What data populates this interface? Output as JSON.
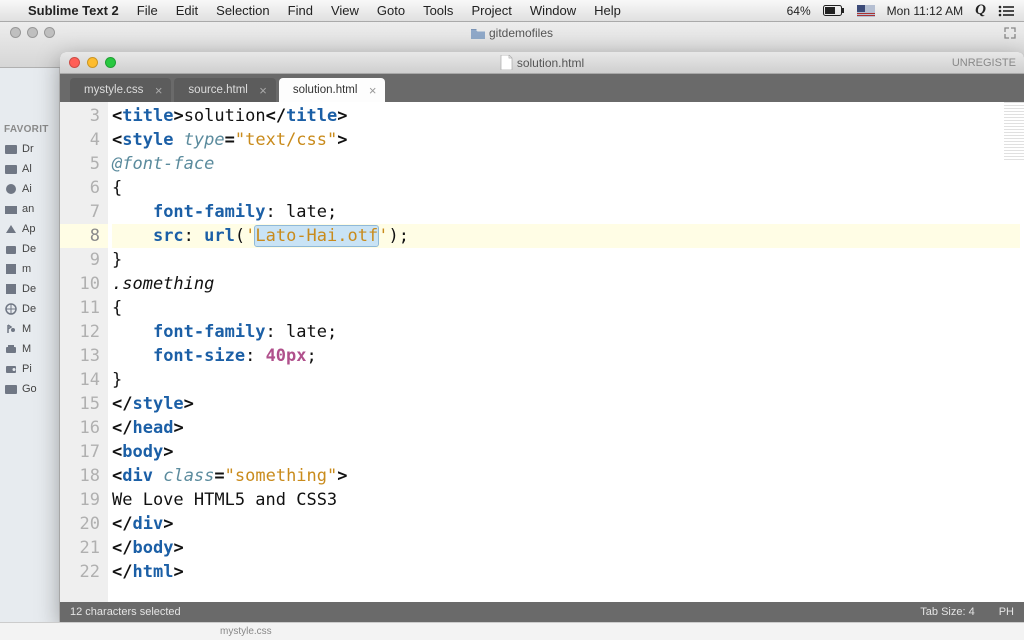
{
  "menubar": {
    "app": "Sublime Text 2",
    "items": [
      "File",
      "Edit",
      "Selection",
      "Find",
      "View",
      "Goto",
      "Tools",
      "Project",
      "Window",
      "Help"
    ],
    "battery": "64%",
    "clock": "Mon 11:12 AM"
  },
  "finder": {
    "title": "gitdemofiles"
  },
  "sidebar": {
    "header": "FAVORIT",
    "items": [
      "Dr",
      "Al",
      "Ai",
      "an",
      "Ap",
      "De",
      "m",
      "De",
      "De",
      "M",
      "M",
      "Pi",
      "Go"
    ]
  },
  "sublime": {
    "title": "solution.html",
    "unregistered": "UNREGISTE",
    "tabs": [
      {
        "label": "mystyle.css",
        "active": false
      },
      {
        "label": "source.html",
        "active": false
      },
      {
        "label": "solution.html",
        "active": true
      }
    ],
    "gutter_start": 3,
    "gutter_end": 22,
    "highlighted_line": 8,
    "selection_text": "Lato-Hai.otf",
    "code": {
      "l3": {
        "tag": "title",
        "text": "solution"
      },
      "l4": {
        "tag": "style",
        "attr": "type",
        "val": "\"text/css\""
      },
      "l5": "@font-face",
      "l6": "{",
      "l7": {
        "prop": "font-family",
        "val": "late"
      },
      "l8": {
        "prop": "src",
        "url": "Lato-Hai.otf"
      },
      "l9": "}",
      "l10": ".something",
      "l11": "{",
      "l12": {
        "prop": "font-family",
        "val": "late"
      },
      "l13": {
        "prop": "font-size",
        "num": "40",
        "unit": "px"
      },
      "l14": "}",
      "l15": {
        "close": "style"
      },
      "l16": {
        "close": "head"
      },
      "l17": {
        "open": "body"
      },
      "l18": {
        "open": "div",
        "attr": "class",
        "val": "\"something\""
      },
      "l19": "We Love HTML5 and CSS3",
      "l20": {
        "close": "div"
      },
      "l21": {
        "close": "body"
      },
      "l22": {
        "close": "html"
      }
    },
    "status": {
      "left": "12 characters selected",
      "tabsize": "Tab Size: 4",
      "syntax": "PH"
    }
  }
}
